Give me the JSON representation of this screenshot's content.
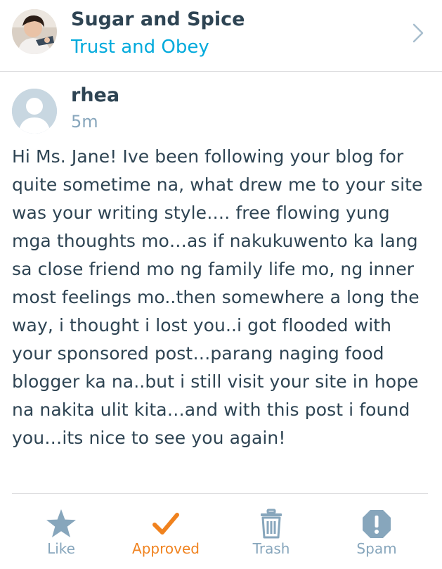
{
  "header": {
    "site_name": "Sugar and Spice",
    "post_title": "Trust and Obey"
  },
  "comment": {
    "author": "rhea",
    "time": "5m",
    "body": "Hi Ms. Jane! Ive been following your blog for quite sometime na, what drew me to your site was your writing style…. free flowing yung mga thoughts mo…as if nakukuwento ka lang sa close friend mo ng family life mo, ng inner most feelings mo..then somewhere a long the way, i thought i lost you..i got flooded with your sponsored post…parang naging food blogger ka na..but i still visit your site in hope na nakita ulit kita…and with this post i found you…its nice to see you again!"
  },
  "actions": {
    "like": "Like",
    "approved": "Approved",
    "trash": "Trash",
    "spam": "Spam"
  },
  "colors": {
    "accent_blue": "#00aadc",
    "approved_orange": "#f0821e",
    "muted": "#87a6bc",
    "text": "#2e4453"
  },
  "icons": {
    "site_avatar": "site-avatar-photo",
    "chevron": "chevron-right-icon",
    "author_avatar": "default-person-icon",
    "like": "star-icon",
    "approved": "checkmark-icon",
    "trash": "trash-icon",
    "spam": "exclamation-icon"
  }
}
